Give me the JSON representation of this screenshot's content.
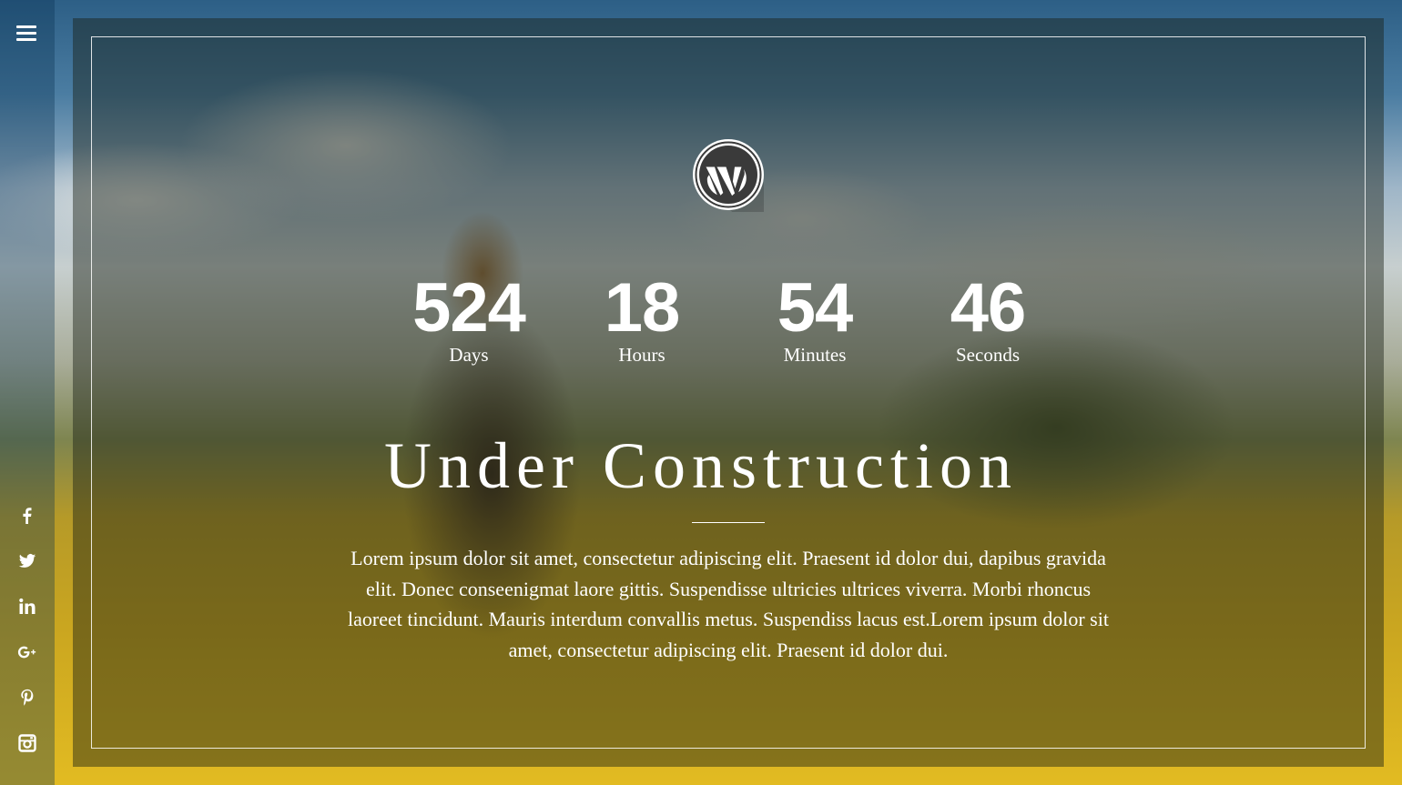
{
  "page": {
    "title": "Under Construction",
    "description": "Lorem ipsum dolor sit amet, consectetur adipiscing elit. Praesent id dolor dui, dapibus gravida elit. Donec conseenigmat laore gittis. Suspendisse ultricies ultrices viverra. Morbi rhoncus laoreet tincidunt. Mauris interdum convallis metus. Suspendiss lacus est.Lorem ipsum dolor sit amet, consectetur adipiscing elit. Praesent id dolor dui."
  },
  "countdown": {
    "days": {
      "value": "524",
      "label": "Days"
    },
    "hours": {
      "value": "18",
      "label": "Hours"
    },
    "minutes": {
      "value": "54",
      "label": "Minutes"
    },
    "seconds": {
      "value": "46",
      "label": "Seconds"
    }
  },
  "sidebar": {
    "menu_icon": "hamburger-menu-icon",
    "social": [
      {
        "name": "facebook-icon",
        "glyph": "f"
      },
      {
        "name": "twitter-icon",
        "glyph": "t"
      },
      {
        "name": "linkedin-icon",
        "glyph": "in"
      },
      {
        "name": "google-plus-icon",
        "glyph": "g+"
      },
      {
        "name": "pinterest-icon",
        "glyph": "p"
      },
      {
        "name": "instagram-icon",
        "glyph": "instagram"
      }
    ]
  },
  "logo": {
    "icon": "wordpress-logo-icon"
  },
  "colors": {
    "text": "#ffffff",
    "overlay": "#191e14",
    "sidebar": "#0a3250"
  }
}
